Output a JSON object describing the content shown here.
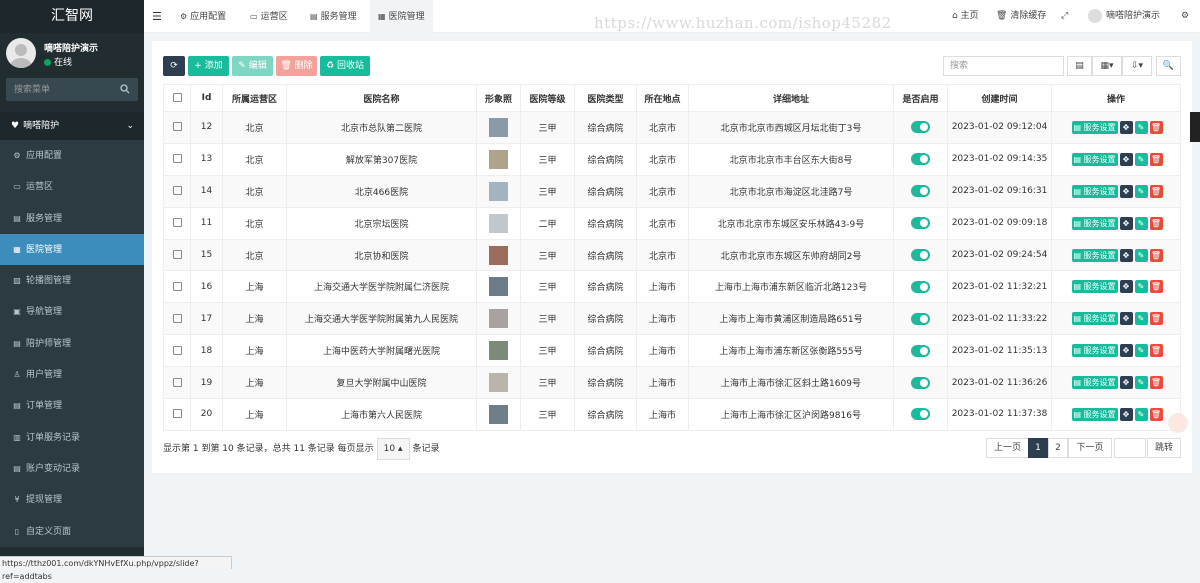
{
  "app": {
    "brand": "汇智网"
  },
  "user": {
    "name": "嘀嗒陪护演示",
    "status": "在线"
  },
  "sidebar": {
    "search_placeholder": "搜索菜单",
    "group": "嘀嗒陪护",
    "items": [
      {
        "label": "应用配置",
        "icon": "gear-icon"
      },
      {
        "label": "运营区",
        "icon": "map-icon"
      },
      {
        "label": "服务管理",
        "icon": "list-icon"
      },
      {
        "label": "医院管理",
        "icon": "hospital-icon"
      },
      {
        "label": "轮播图管理",
        "icon": "image-icon"
      },
      {
        "label": "导航管理",
        "icon": "nav-icon"
      },
      {
        "label": "陪护师管理",
        "icon": "id-card-icon"
      },
      {
        "label": "用户管理",
        "icon": "user-icon"
      },
      {
        "label": "订单管理",
        "icon": "order-icon"
      },
      {
        "label": "订单服务记录",
        "icon": "record-icon"
      },
      {
        "label": "账户变动记录",
        "icon": "account-icon"
      },
      {
        "label": "提现管理",
        "icon": "yen-icon"
      },
      {
        "label": "自定义页面",
        "icon": "page-icon"
      }
    ],
    "active_index": 3
  },
  "topbar": {
    "tabs": [
      "应用配置",
      "运营区",
      "服务管理",
      "医院管理"
    ],
    "active_tab": 3,
    "watermark": "https://www.huzhan.com/ishop45282",
    "home": "主页",
    "clear_cache": "清除缓存",
    "user": "嘀嗒陪护演示"
  },
  "toolbar": {
    "add": "添加",
    "edit": "编辑",
    "delete": "删除",
    "recycle": "回收站",
    "search_placeholder": "搜索"
  },
  "table": {
    "headers": [
      "Id",
      "所属运营区",
      "医院名称",
      "形象照",
      "医院等级",
      "医院类型",
      "所在地点",
      "详细地址",
      "是否启用",
      "创建时间",
      "操作"
    ],
    "service_label": "服务设置",
    "rows": [
      {
        "id": "12",
        "region": "北京",
        "name": "北京市总队第二医院",
        "level": "三甲",
        "type": "综合病院",
        "city": "北京市",
        "address": "北京市北京市西城区月坛北街丁3号",
        "created": "2023-01-02 09:12:04"
      },
      {
        "id": "13",
        "region": "北京",
        "name": "解放军第307医院",
        "level": "三甲",
        "type": "综合病院",
        "city": "北京市",
        "address": "北京市北京市丰台区东大街8号",
        "created": "2023-01-02 09:14:35"
      },
      {
        "id": "14",
        "region": "北京",
        "name": "北京466医院",
        "level": "三甲",
        "type": "综合病院",
        "city": "北京市",
        "address": "北京市北京市海淀区北洼路7号",
        "created": "2023-01-02 09:16:31"
      },
      {
        "id": "11",
        "region": "北京",
        "name": "北京宗坛医院",
        "level": "二甲",
        "type": "综合病院",
        "city": "北京市",
        "address": "北京市北京市东城区安乐林路43-9号",
        "created": "2023-01-02 09:09:18"
      },
      {
        "id": "15",
        "region": "北京",
        "name": "北京协和医院",
        "level": "三甲",
        "type": "综合病院",
        "city": "北京市",
        "address": "北京市北京市东城区东帅府胡同2号",
        "created": "2023-01-02 09:24:54"
      },
      {
        "id": "16",
        "region": "上海",
        "name": "上海交通大学医学院附属仁济医院",
        "level": "三甲",
        "type": "综合病院",
        "city": "上海市",
        "address": "上海市上海市浦东新区临沂北路123号",
        "created": "2023-01-02 11:32:21"
      },
      {
        "id": "17",
        "region": "上海",
        "name": "上海交通大学医学院附属第九人民医院",
        "level": "三甲",
        "type": "综合病院",
        "city": "上海市",
        "address": "上海市上海市黄浦区制造局路651号",
        "created": "2023-01-02 11:33:22"
      },
      {
        "id": "18",
        "region": "上海",
        "name": "上海中医药大学附属曙光医院",
        "level": "三甲",
        "type": "综合病院",
        "city": "上海市",
        "address": "上海市上海市浦东新区张衡路555号",
        "created": "2023-01-02 11:35:13"
      },
      {
        "id": "19",
        "region": "上海",
        "name": "复旦大学附属中山医院",
        "level": "三甲",
        "type": "综合病院",
        "city": "上海市",
        "address": "上海市上海市徐汇区斜土路1609号",
        "created": "2023-01-02 11:36:26"
      },
      {
        "id": "20",
        "region": "上海",
        "name": "上海市第六人民医院",
        "level": "三甲",
        "type": "综合病院",
        "city": "上海市",
        "address": "上海市上海市徐汇区沪闵路9816号",
        "created": "2023-01-02 11:37:38"
      }
    ]
  },
  "pagination": {
    "summary": "显示第 1 到第 10 条记录，总共 11 条记录 每页显示",
    "page_size": "10",
    "suffix": "条记录",
    "prev": "上一页",
    "pages": [
      "1",
      "2"
    ],
    "next": "下一页",
    "jump": "跳转"
  },
  "statusbar": {
    "url": "https://tthz001.com/dkYNHvEfXu.php/vppz/slide?ref=addtabs"
  },
  "colors": {
    "sidebar": "#222d32",
    "active": "#3c8dbc",
    "success": "#18bc9c",
    "danger": "#e74c3c",
    "dark": "#2c3e50"
  }
}
